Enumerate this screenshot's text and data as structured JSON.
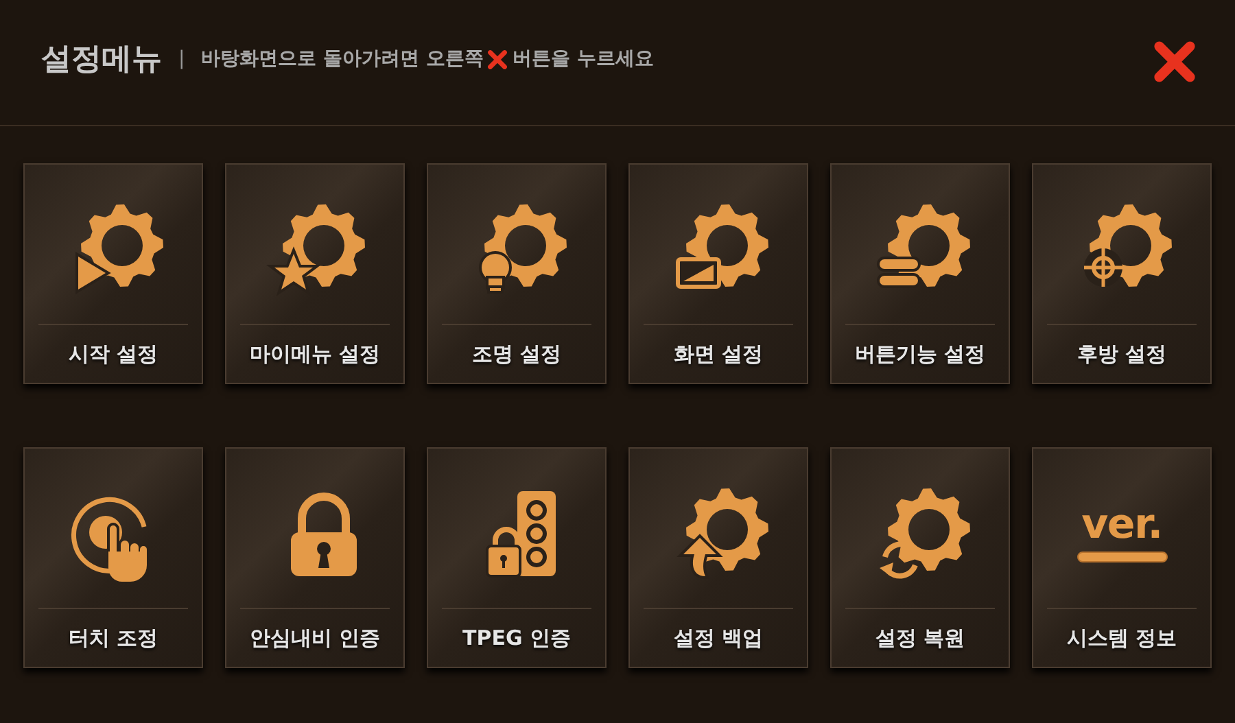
{
  "header": {
    "title": "설정메뉴",
    "separator": "|",
    "hint_before": "바탕화면으로 돌아가려면 오른쪽",
    "hint_after": "버튼을 누르세요"
  },
  "tiles": [
    {
      "kind": "start",
      "label": "시작 설정"
    },
    {
      "kind": "mymenu",
      "label": "마이메뉴 설정"
    },
    {
      "kind": "lighting",
      "label": "조명 설정"
    },
    {
      "kind": "screen",
      "label": "화면 설정"
    },
    {
      "kind": "buttons",
      "label": "버튼기능 설정"
    },
    {
      "kind": "rear",
      "label": "후방 설정"
    },
    {
      "kind": "touch",
      "label": "터치 조정"
    },
    {
      "kind": "lock",
      "label": "안심내비 인증"
    },
    {
      "kind": "tpeg",
      "label": "TPEG 인증"
    },
    {
      "kind": "backup",
      "label": "설정 백업"
    },
    {
      "kind": "restore",
      "label": "설정 복원"
    },
    {
      "kind": "version",
      "label": "시스템 정보",
      "icon_text": "ver."
    }
  ]
}
